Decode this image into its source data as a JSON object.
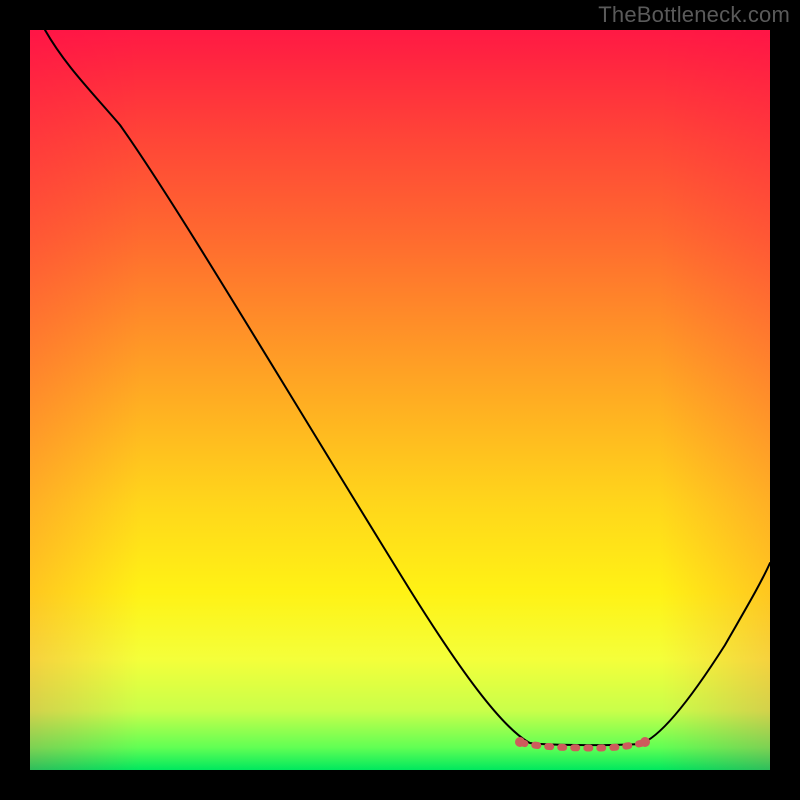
{
  "watermark": "TheBottleneck.com",
  "colors": {
    "background": "#000000",
    "curve": "#000000",
    "optimal_marker": "#cd5c5c",
    "gradient_top": "#ff1944",
    "gradient_bottom": "#00e85e"
  },
  "chart_data": {
    "type": "line",
    "title": "",
    "xlabel": "",
    "ylabel": "",
    "xlim": [
      0,
      100
    ],
    "ylim": [
      0,
      100
    ],
    "series": [
      {
        "name": "bottleneck-curve",
        "x": [
          2,
          6,
          10,
          16,
          22,
          28,
          34,
          40,
          46,
          52,
          58,
          62,
          66,
          70,
          74,
          78,
          82,
          86,
          90,
          94,
          98,
          100
        ],
        "values": [
          100,
          97,
          94,
          88,
          80,
          71,
          62,
          53,
          44,
          35,
          26,
          20,
          14,
          9,
          5,
          2,
          1,
          3,
          8,
          15,
          23,
          28
        ]
      }
    ],
    "optimal_region": {
      "x_start": 66,
      "x_end": 84,
      "description": "flat minimum segment highlighted with dotted pink line"
    },
    "background_gradient": {
      "direction": "vertical",
      "stops": [
        {
          "pos": 0,
          "color": "#ff1944"
        },
        {
          "pos": 15,
          "color": "#ff4637"
        },
        {
          "pos": 40,
          "color": "#ff8f28"
        },
        {
          "pos": 64,
          "color": "#ffd61b"
        },
        {
          "pos": 85,
          "color": "#f4ff3a"
        },
        {
          "pos": 100,
          "color": "#00e85e"
        }
      ]
    }
  }
}
